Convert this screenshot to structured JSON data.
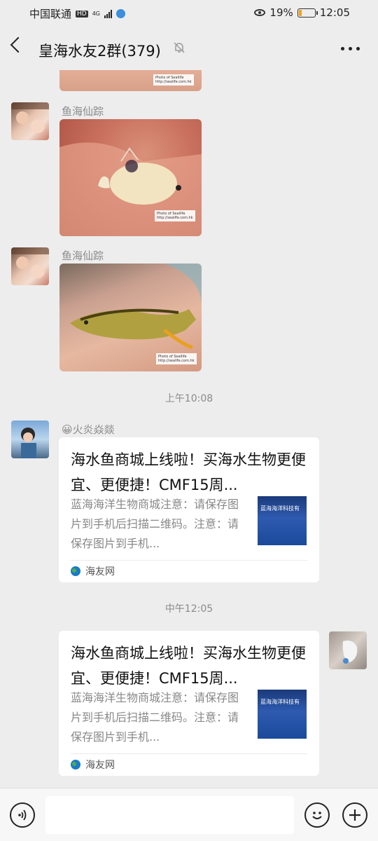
{
  "status_bar": {
    "carrier": "中国联通",
    "hd": "HD",
    "network": "4G",
    "battery_percent": "19%",
    "time": "12:05"
  },
  "header": {
    "title": "皇海水友2群(379)"
  },
  "messages": [
    {
      "sender": "鱼海仙踪",
      "watermark_line1": "Photo of Seallife",
      "watermark_line2": "http://seallfe.com.hk"
    },
    {
      "sender": "鱼海仙踪",
      "watermark_line1": "Photo of Seallife",
      "watermark_line2": "http://seallfe.com.hk"
    }
  ],
  "top_image_watermark": {
    "line1": "Photo of Seallife",
    "line2": "http://seallfe.com.hk"
  },
  "timestamps": [
    "上午10:08",
    "中午12:05"
  ],
  "link_cards": [
    {
      "sender": "😀火炎焱燚",
      "title": "海水鱼商城上线啦！买海水生物更便宜、更便捷！CMF15周...",
      "desc": "蓝海海洋生物商城注意：请保存图片到手机后扫描二维码。注意：请保存图片到手机...",
      "source": "海友网",
      "thumb_text": "蓝海海洋科技有"
    },
    {
      "title": "海水鱼商城上线啦！买海水生物更便宜、更便捷！CMF15周...",
      "desc": "蓝海海洋生物商城注意：请保存图片到手机后扫描二维码。注意：请保存图片到手机...",
      "source": "海友网",
      "thumb_text": "蓝海海洋科技有"
    }
  ],
  "icons": {
    "back": "back-arrow-icon",
    "mute": "mute-bell-icon",
    "more": "more-dots-icon",
    "voice": "voice-icon",
    "emoji": "emoji-icon",
    "plus": "plus-icon"
  }
}
